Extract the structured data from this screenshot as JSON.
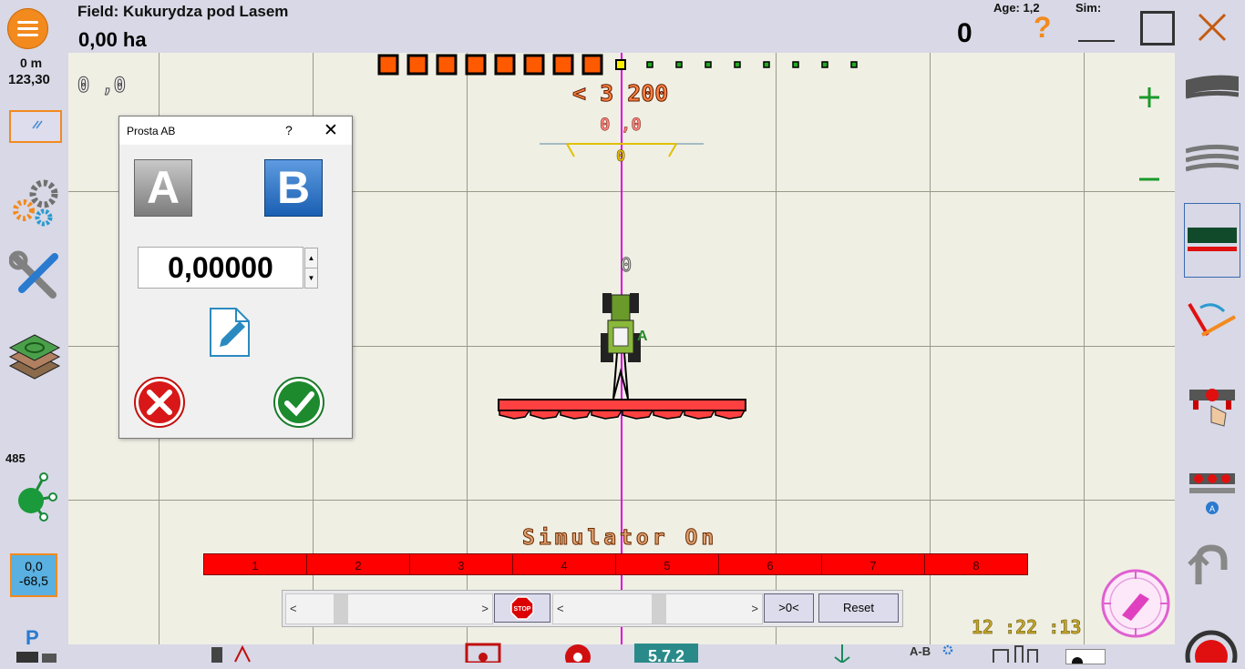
{
  "header": {
    "field_name": "Field: Kukurydza pod Lasem",
    "area": "0,00 ha",
    "age_label": "Age: 1,2",
    "sim_label": "Sim:",
    "count": "0",
    "help": "?"
  },
  "left_panel": {
    "distance": "0 m",
    "heading": "123,30",
    "satellites": "485",
    "offset_top": "0,0",
    "offset_bottom": "-68,5",
    "p_label": "P"
  },
  "map": {
    "corner_readout": "0 ,0",
    "lightbar_value": "< 3 200",
    "xte_value": "0 ,0",
    "guidance_zero": "0",
    "tractor_zero": "0",
    "status_text": "Simulator On",
    "sections": [
      "1",
      "2",
      "3",
      "4",
      "5",
      "6",
      "7",
      "8"
    ],
    "section_squares_on": 8,
    "section_squares_off": 8,
    "clock": "12 :22 :13"
  },
  "controls": {
    "left_arrow": "<",
    "right_arrow": ">",
    "stop_label": "STOP",
    "zero_label": ">0<",
    "reset_label": "Reset"
  },
  "dialog": {
    "title": "Prosta AB",
    "help": "?",
    "close": "✕",
    "a_label": "A",
    "b_label": "B",
    "heading_value": "0,00000"
  },
  "bottom": {
    "version": "5.7.2",
    "ab_label": "A-B"
  },
  "colors": {
    "accent_orange": "#f28a1e",
    "section_red": "#ff0000",
    "guide_line": "#e000e0",
    "sidebar_bg": "#d8d8e6"
  }
}
